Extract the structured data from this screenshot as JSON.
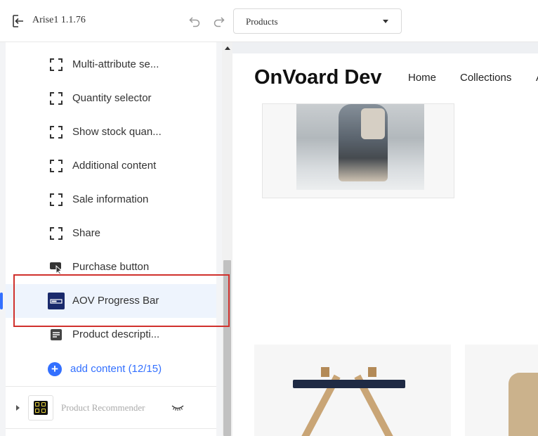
{
  "app": {
    "title": "Arise1  1.1.76"
  },
  "toolbar": {
    "page_select_value": "Products"
  },
  "sidebar": {
    "blocks": [
      {
        "label": "Multi-attribute se...",
        "icon": "frame-icon"
      },
      {
        "label": "Quantity selector",
        "icon": "frame-icon"
      },
      {
        "label": "Show stock quan...",
        "icon": "frame-icon"
      },
      {
        "label": "Additional content",
        "icon": "frame-icon"
      },
      {
        "label": "Sale information",
        "icon": "frame-icon"
      },
      {
        "label": "Share",
        "icon": "frame-icon"
      },
      {
        "label": "Purchase button",
        "icon": "purchase-button-icon"
      },
      {
        "label": "AOV Progress Bar",
        "icon": "progress-bar-icon",
        "active": true
      },
      {
        "label": "Product descripti...",
        "icon": "document-icon"
      }
    ],
    "add_content_label": "add content (12/15)",
    "section": {
      "label": "Product Recommender",
      "icon": "app-grid-icon",
      "visibility_icon": "eye-off-icon"
    }
  },
  "preview": {
    "store_name": "OnVoard Dev",
    "nav": [
      "Home",
      "Collections",
      "A"
    ]
  },
  "colors": {
    "accent": "#3370ff",
    "highlight": "#d0312d",
    "active_bg": "#eef4fd"
  }
}
